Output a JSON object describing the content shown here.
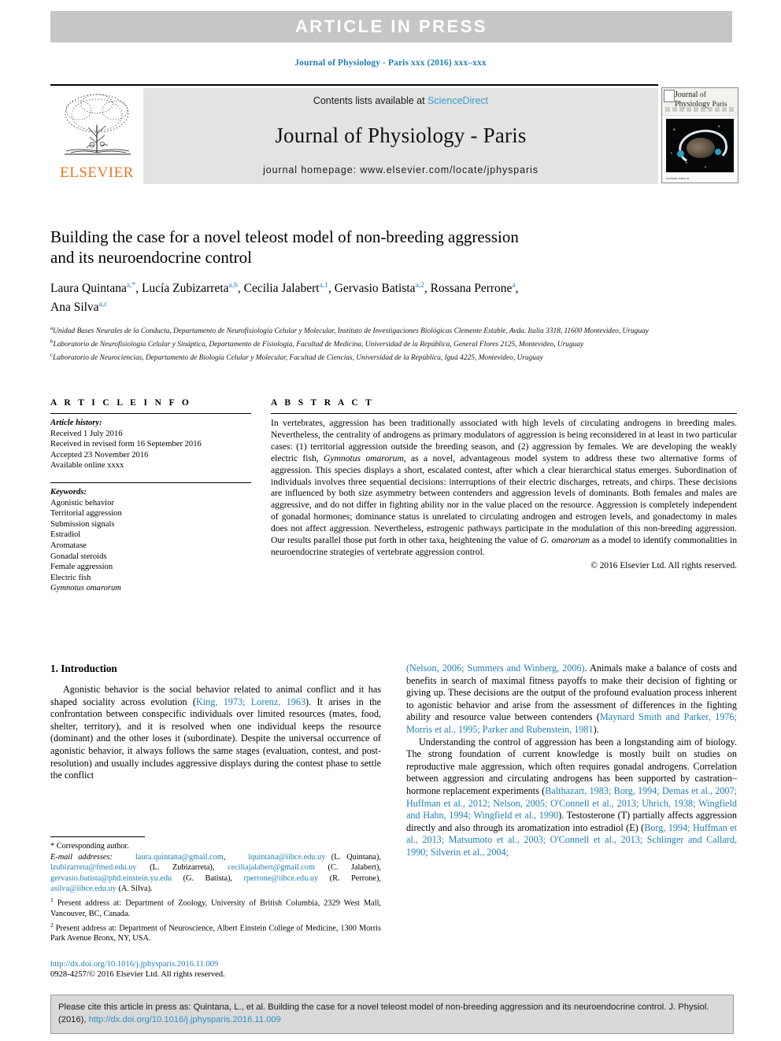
{
  "banner": {
    "text": "ARTICLE  IN  PRESS"
  },
  "running_head": "Journal of Physiology - Paris xxx (2016) xxx–xxx",
  "masthead": {
    "publisher": "ELSEVIER",
    "contents_prefix": "Contents lists available at ",
    "contents_link": "ScienceDirect",
    "journal_title": "Journal of Physiology - Paris",
    "homepage": "journal homepage: www.elsevier.com/locate/jphysparis",
    "cover": {
      "line1": "Journal",
      "line1b": "of",
      "line2": "Physiology",
      "line2b": "Paris",
      "footer": "Available online at"
    }
  },
  "article": {
    "title_line1": "Building the case for a novel teleost model of non-breeding aggression",
    "title_line2": "and its neuroendocrine control",
    "authors": [
      {
        "name": "Laura Quintana",
        "sup": "a,*"
      },
      {
        "name": "Lucía Zubizarreta",
        "sup": "a,b"
      },
      {
        "name": "Cecilia Jalabert",
        "sup": "a,1"
      },
      {
        "name": "Gervasio Batista",
        "sup": "a,2"
      },
      {
        "name": "Rossana Perrone",
        "sup": "a"
      },
      {
        "name": "Ana Silva",
        "sup": "a,c"
      }
    ],
    "affiliations": [
      {
        "sup": "a",
        "text": "Unidad Bases Neurales de la Conducta, Departamento de Neurofisiología Celular y Molecular, Instituto de Investigaciones Biológicas Clemente Estable, Avda. Italia 3318, 11600 Montevideo, Uruguay"
      },
      {
        "sup": "b",
        "text": "Laboratorio de Neurofisiología Celular y Sináptica, Departamento de Fisiología, Facultad de Medicina, Universidad de la República, General Flores 2125, Montevideo, Uruguay"
      },
      {
        "sup": "c",
        "text": "Laboratorio de Neurociencias, Departamento de Biología Celular y Molecular, Facultad de Ciencias, Universidad de la República, Iguá 4225, Montevideo, Uruguay"
      }
    ]
  },
  "article_info": {
    "heading": "A R T I C L E   I N F O",
    "history_label": "Article history:",
    "history": [
      "Received 1 July 2016",
      "Received in revised form 16 September 2016",
      "Accepted 23 November 2016",
      "Available online xxxx"
    ],
    "keywords_label": "Keywords:",
    "keywords": [
      "Agonistic behavior",
      "Territorial aggression",
      "Submission signals",
      "Estradiol",
      "Aromatase",
      "Gonadal steroids",
      "Female aggression",
      "Electric fish",
      "Gymnotus omarorum"
    ]
  },
  "abstract": {
    "heading": "A B S T R A C T",
    "text_part1": "In vertebrates, aggression has been traditionally associated with high levels of circulating androgens in breeding males. Nevertheless, the centrality of androgens as primary modulators of aggression is being reconsidered in at least in two particular cases: (1) territorial aggression outside the breeding season, and (2) aggression by females. We are developing the weakly electric fish, ",
    "species1": "Gymnotus omarorum",
    "text_part2": ", as a novel, advantageous model system to address these two alternative forms of aggression. This species displays a short, escalated contest, after which a clear hierarchical status emerges. Subordination of individuals involves three sequential decisions: interruptions of their electric discharges, retreats, and chirps. These decisions are influenced by both size asymmetry between contenders and aggression levels of dominants. Both females and males are aggressive, and do not differ in fighting ability nor in the value placed on the resource. Aggression is completely independent of gonadal hormones; dominance status is unrelated to circulating androgen and estrogen levels, and gonadectomy in males does not affect aggression. Nevertheless, estrogenic pathways participate in the modulation of this non-breeding aggression. Our results parallel those put forth in other taxa, heightening the value of ",
    "species2": "G. omarorum",
    "text_part3": " as a model to identify commonalities in neuroendocrine strategies of vertebrate aggression control.",
    "copyright": "© 2016 Elsevier Ltd. All rights reserved."
  },
  "introduction": {
    "heading": "1. Introduction",
    "left_p1_a": "Agonistic behavior is the social behavior related to animal conflict and it has shaped sociality across evolution (",
    "left_p1_ref1": "King, 1973; Lorenz, 1963",
    "left_p1_b": "). It arises in the confrontation between conspecific individuals over limited resources (mates, food, shelter, territory), and it is resolved when one individual keeps the resource (dominant) and the other loses it (subordinate). Despite the universal occurrence of agonistic behavior, it always follows the same stages (evaluation, contest, and post-resolution) and usually includes aggressive displays during the contest phase to settle the conflict",
    "right_p1_ref1": "(Nelson, 2006; Summers and Winberg, 2006)",
    "right_p1_a": ". Animals make a balance of costs and benefits in search of maximal fitness payoffs to make their decision of fighting or giving up. These decisions are the output of the profound evaluation process inherent to agonistic behavior and arise from the assessment of differences in the fighting ability and resource value between contenders (",
    "right_p1_ref2": "Maynard Smith and Parker, 1976; Morris et al., 1995; Parker and Rubenstein, 1981",
    "right_p1_b": ").",
    "right_p2_a": "Understanding the control of aggression has been a longstanding aim of biology. The strong foundation of current knowledge is mostly built on studies on reproductive male aggression, which often requires gonadal androgens. Correlation between aggression and circulating androgens has been supported by castration–hormone replacement experiments (",
    "right_p2_ref1": "Balthazart, 1983; Borg, 1994; Demas et al., 2007; Huffman et al., 2012; Nelson, 2005; O'Connell et al., 2013; Uhrich, 1938; Wingfield and Hahn, 1994; Wingfield et al., 1990",
    "right_p2_b": "). Testosterone (T) partially affects aggression directly and also through its aromatization into estradiol (E) (",
    "right_p2_ref2": "Borg, 1994; Huffman et al., 2013; Matsumoto et al., 2003; O'Connell et al., 2013; Schlinger and Callard, 1990; Silverin et al., 2004;"
  },
  "footnotes": {
    "corresponding": "* Corresponding author.",
    "email_label": "E-mail addresses:",
    "emails": [
      {
        "addr": "laura.quintana@gmail.com",
        "sep": ", "
      },
      {
        "addr": "lquintana@iibce.edu.uy",
        "sep": " "
      },
      {
        "owner": "(L. Quintana), "
      },
      {
        "addr": "lzubizarreta@fmed.edu.uy",
        "sep": " "
      },
      {
        "owner": "(L. Zubizarreta), "
      },
      {
        "addr": "ceciliajalabert@gmail.com",
        "sep": " "
      },
      {
        "owner": "(C. Jalabert), "
      },
      {
        "addr": "gervasio.batista@phd.einstein.yu.edu",
        "sep": " "
      },
      {
        "owner": "(G. Batista), "
      },
      {
        "addr": "rperrone@iibce.edu.uy",
        "sep": " "
      },
      {
        "owner": "(R. Perrone), "
      },
      {
        "addr": "asilva@iibce.edu.uy",
        "sep": " "
      },
      {
        "owner": "(A. Silva)."
      }
    ],
    "note1_sup": "1",
    "note1": "Present address at: Department of Zoology, University of British Columbia, 2329 West Mall, Vancouver, BC, Canada.",
    "note2_sup": "2",
    "note2": "Present address at: Department of Neuroscience, Albert Einstein College of Medicine, 1300 Morris Park Avenue Bronx, NY, USA.",
    "doi": "http://dx.doi.org/10.1016/j.jphysparis.2016.11.009",
    "issn_line": "0928-4257/© 2016 Elsevier Ltd. All rights reserved."
  },
  "cite_footer": {
    "text": "Please cite this article in press as: Quintana, L., et al. Building the case for a novel teleost model of non-breeding aggression and its neuroendocrine control. J. Physiol. (2016), ",
    "link": "http://dx.doi.org/10.1016/j.jphysparis.2016.11.009"
  },
  "colors": {
    "link_blue": "#1f7fb6",
    "banner_gray": "#c6c6c6",
    "masthead_gray": "#e3e3e3",
    "elsevier_orange": "#e87722",
    "cite_gray": "#d9d9d9"
  }
}
